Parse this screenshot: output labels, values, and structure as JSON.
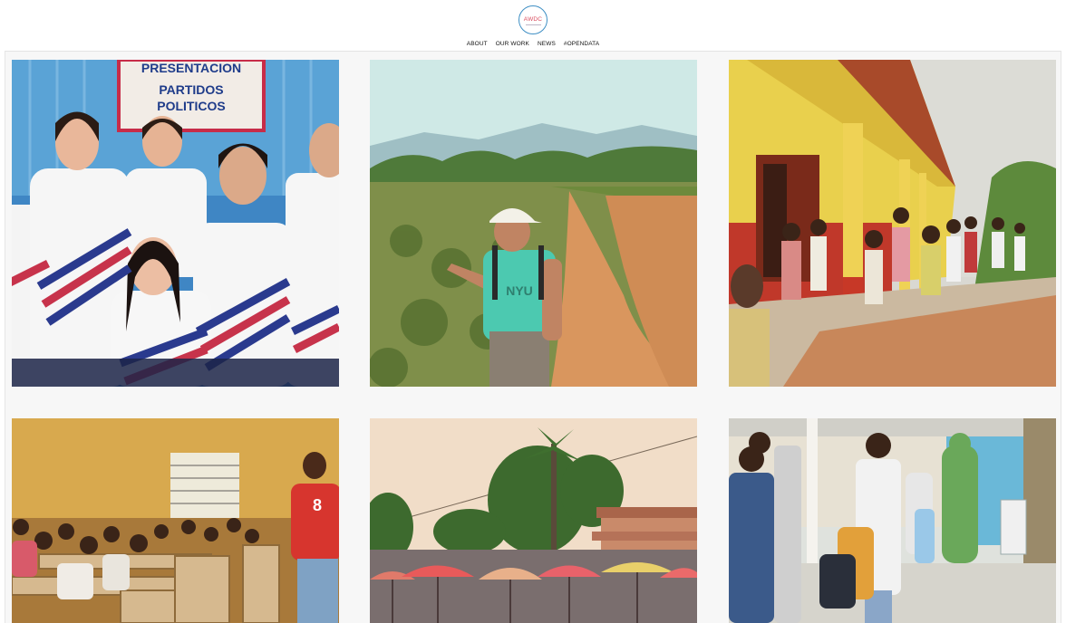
{
  "header": {
    "logo_text": "AWDC",
    "nav": [
      "ABOUT",
      "OUR WORK",
      "NEWS",
      "#OPENDATA"
    ]
  },
  "photos": [
    {
      "sign_lines": [
        "PRESENTACION",
        "PARTIDOS",
        "POLITICOS"
      ],
      "jersey_text": "8"
    }
  ],
  "colors": {
    "logo_ring": "#3f8fc4",
    "logo_text": "#d94c5e",
    "panel_bg": "#f7f7f7"
  }
}
